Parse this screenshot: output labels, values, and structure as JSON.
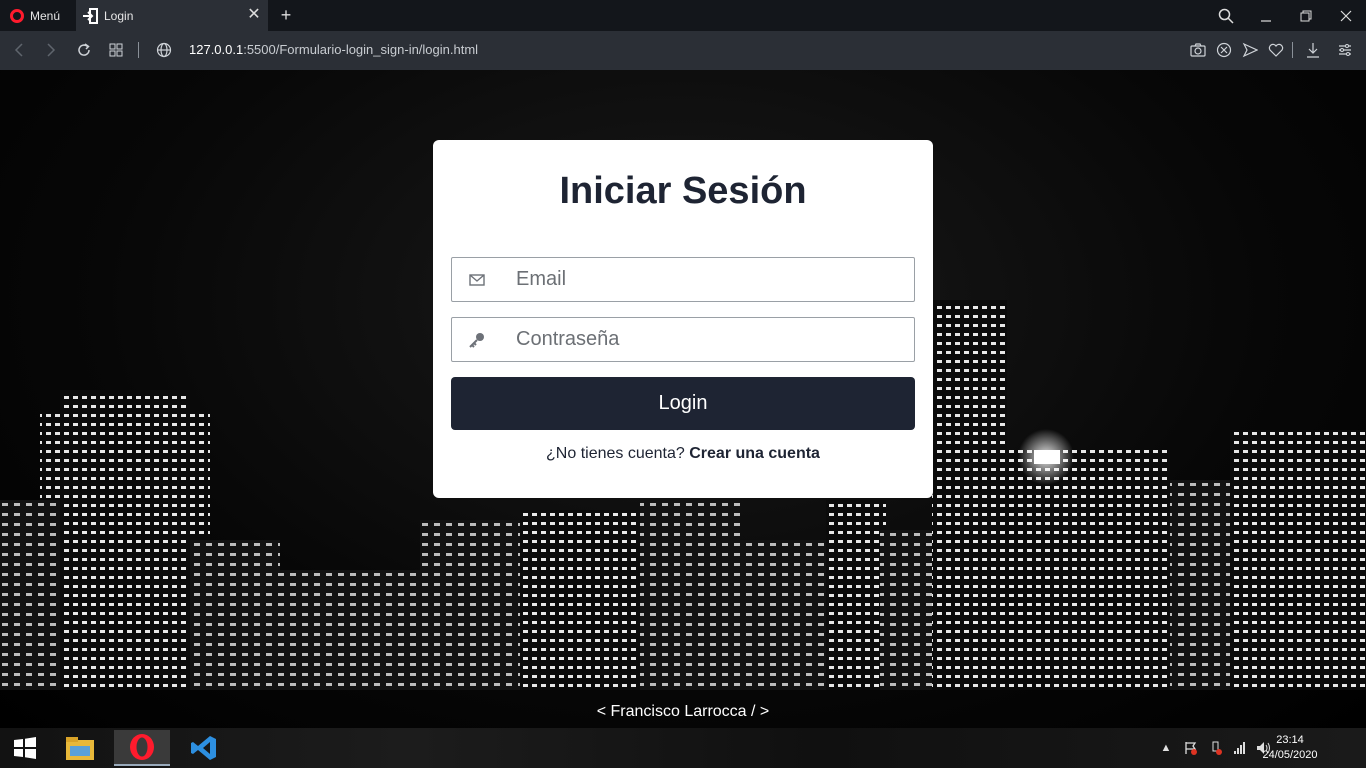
{
  "browser": {
    "menu_label": "Menú",
    "tab_title": "Login",
    "new_tab_symbol": "+",
    "url_host": "127.0.0.1",
    "url_rest": ":5500/Formulario-login_sign-in/login.html",
    "accent": "#ff1b2d"
  },
  "login_card": {
    "title": "Iniciar Sesión",
    "email_placeholder": "Email",
    "password_placeholder": "Contraseña",
    "login_label": "Login",
    "no_account_text": "¿No tienes cuenta?",
    "create_account_link": "Crear una cuenta",
    "primary_color": "#1e2433"
  },
  "footer": {
    "credit": "< Francisco Larrocca / >"
  },
  "taskbar": {
    "time": "23:14",
    "date": "24/05/2020",
    "apps": [
      "file-explorer-icon",
      "opera-browser-icon",
      "vscode-icon"
    ]
  }
}
